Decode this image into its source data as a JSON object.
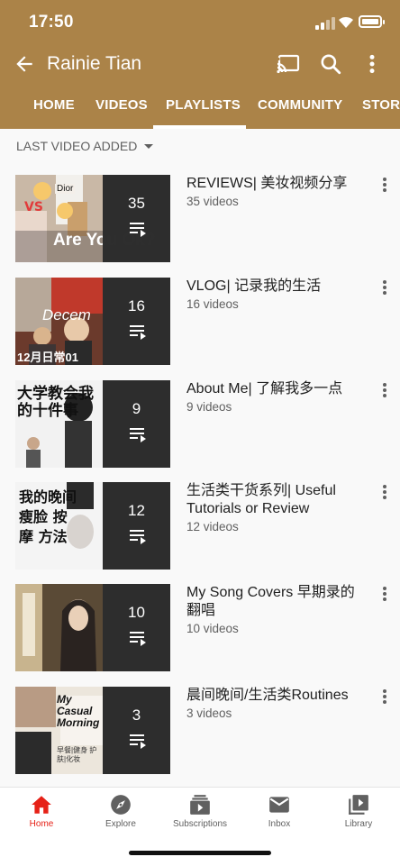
{
  "status": {
    "time": "17:50"
  },
  "appbar": {
    "title": "Rainie Tian"
  },
  "tabs": [
    "HOME",
    "VIDEOS",
    "PLAYLISTS",
    "COMMUNITY",
    "STORI"
  ],
  "active_tab": "PLAYLISTS",
  "sort": {
    "label": "LAST VIDEO ADDED"
  },
  "playlists": [
    {
      "count": "35",
      "title": "REVIEWS| 美妆视频分享",
      "videos": "35 videos",
      "thumb_text": "Are You Ok?",
      "thumb_badge": "Dior"
    },
    {
      "count": "16",
      "title": "VLOG| 记录我的生活",
      "videos": "16 videos",
      "thumb_text": "Decem",
      "thumb_badge": "12月日常01"
    },
    {
      "count": "9",
      "title": "About Me| 了解我多一点",
      "videos": "9 videos",
      "thumb_text": "大学教会我的十件事",
      "thumb_badge": ""
    },
    {
      "count": "12",
      "title": "生活类干货系列| Useful Tutorials or Review",
      "videos": "12 videos",
      "thumb_text": "我的晚间 瘦脸 按摩 方法",
      "thumb_badge": ""
    },
    {
      "count": "10",
      "title": "My Song Covers 早期录的翻唱",
      "videos": "10 videos",
      "thumb_text": "",
      "thumb_badge": ""
    },
    {
      "count": "3",
      "title": "晨间晚间/生活类Routines",
      "videos": "3 videos",
      "thumb_text": "My Casual Morning",
      "thumb_badge": "早餐|健身 护肤|化妆"
    }
  ],
  "bottom_nav": [
    {
      "label": "Home",
      "icon": "home-icon",
      "active": true
    },
    {
      "label": "Explore",
      "icon": "explore-icon",
      "active": false
    },
    {
      "label": "Subscriptions",
      "icon": "subscriptions-icon",
      "active": false
    },
    {
      "label": "Inbox",
      "icon": "inbox-icon",
      "active": false
    },
    {
      "label": "Library",
      "icon": "library-icon",
      "active": false
    }
  ],
  "colors": {
    "header": "#ab8348",
    "active_nav": "#e62117",
    "text_secondary": "#606060"
  }
}
